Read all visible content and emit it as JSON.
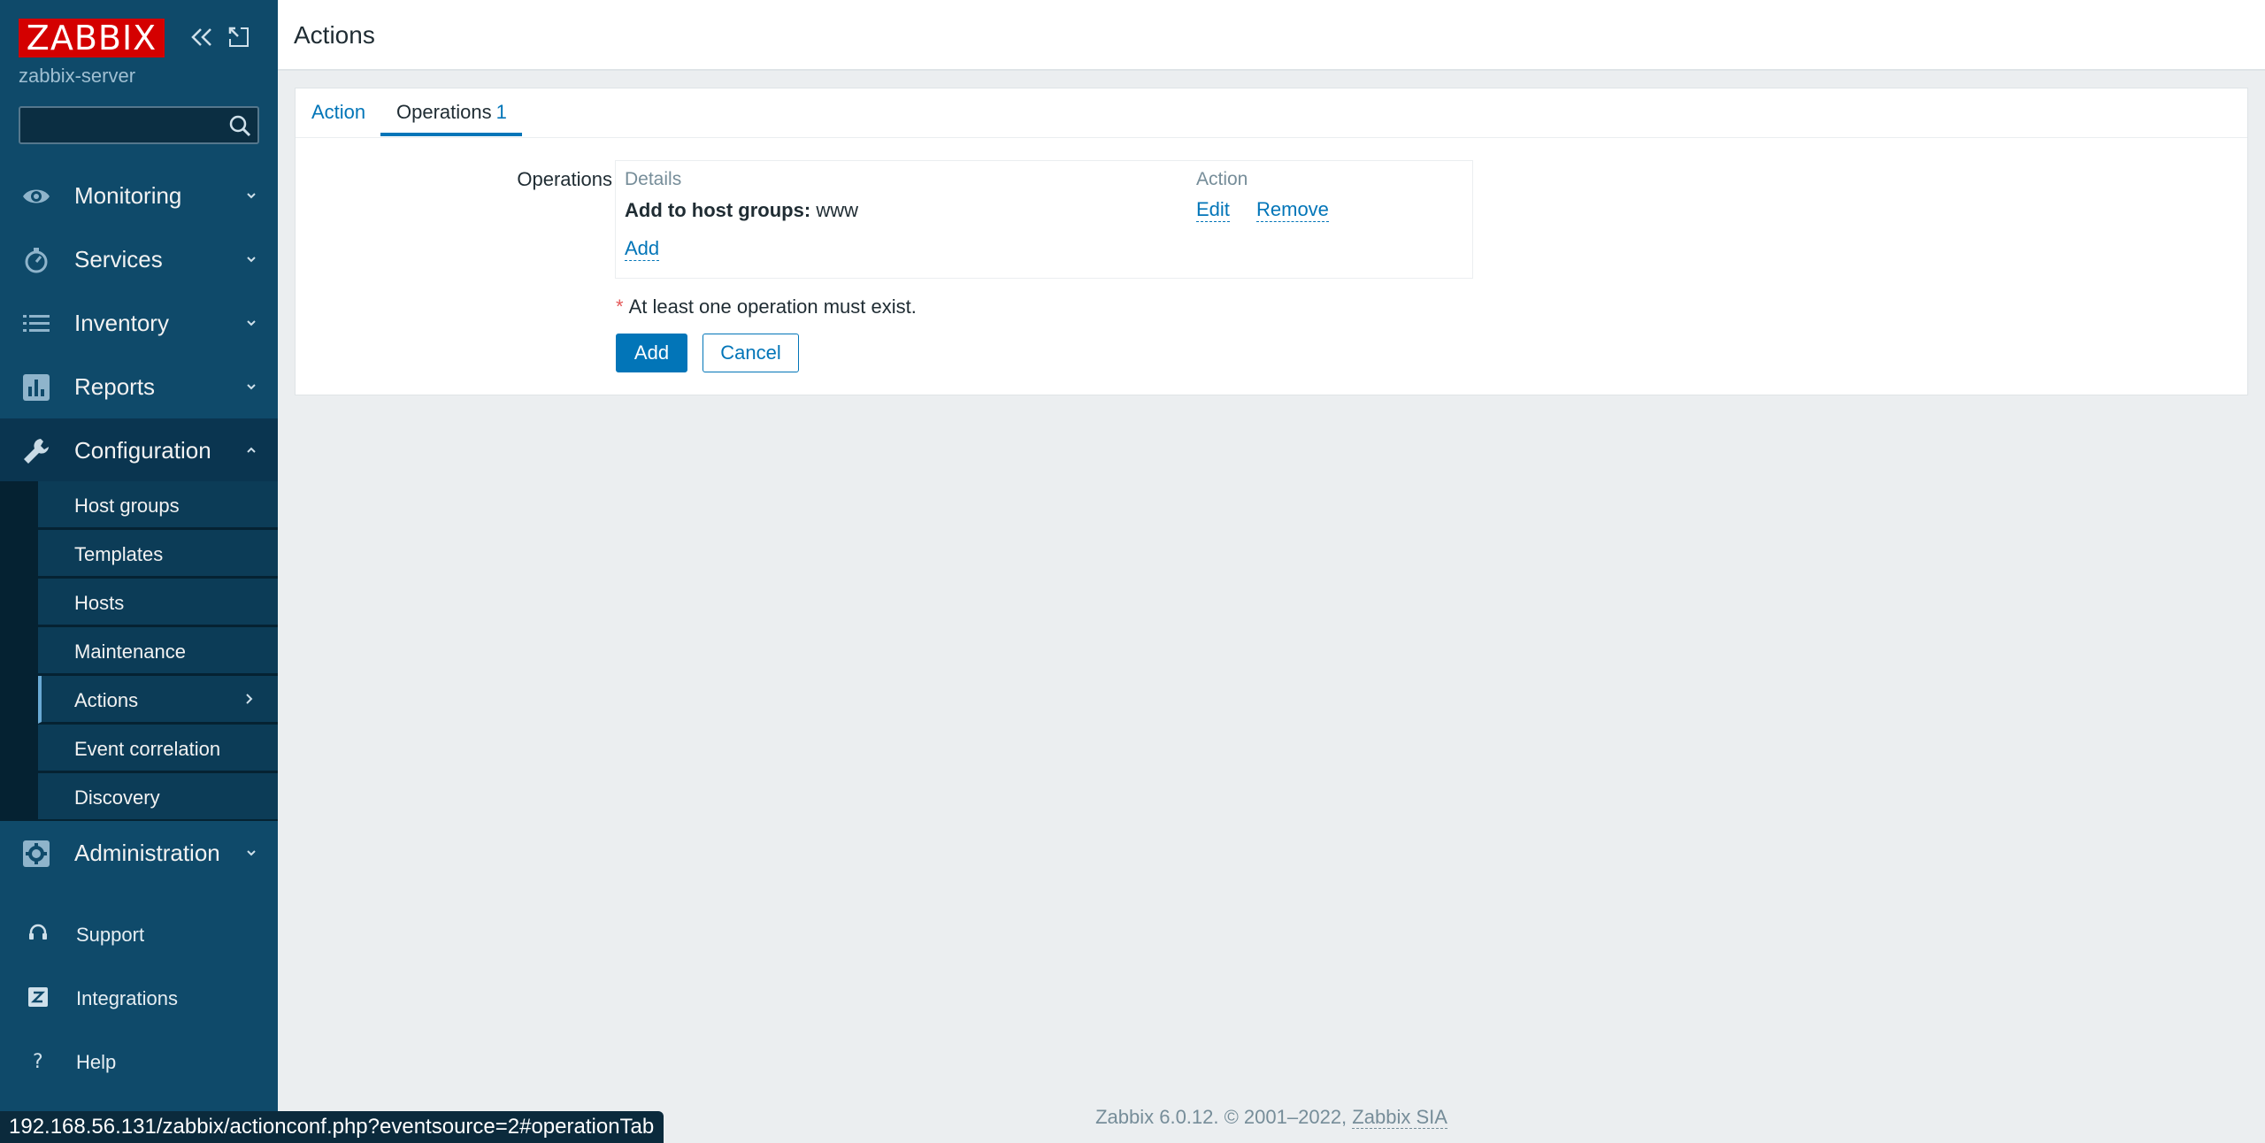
{
  "sidebar": {
    "logo": "ZABBIX",
    "server_name": "zabbix-server",
    "search": {
      "value": "",
      "placeholder": ""
    },
    "menu": [
      {
        "label": "Monitoring",
        "icon": "eye-icon"
      },
      {
        "label": "Services",
        "icon": "stopwatch-icon"
      },
      {
        "label": "Inventory",
        "icon": "list-icon"
      },
      {
        "label": "Reports",
        "icon": "bar-chart-icon"
      },
      {
        "label": "Configuration",
        "icon": "wrench-icon"
      },
      {
        "label": "Administration",
        "icon": "gear-icon"
      }
    ],
    "configuration_submenu": [
      "Host groups",
      "Templates",
      "Hosts",
      "Maintenance",
      "Actions",
      "Event correlation",
      "Discovery"
    ],
    "footer_links": [
      {
        "label": "Support",
        "icon": "headset-icon"
      },
      {
        "label": "Integrations",
        "icon": "z-icon"
      },
      {
        "label": "Help",
        "icon": "question-icon"
      }
    ]
  },
  "header": {
    "title": "Actions"
  },
  "tabs": {
    "action": "Action",
    "operations": "Operations",
    "operations_count": "1"
  },
  "operations": {
    "label": "Operations",
    "col_details": "Details",
    "col_action": "Action",
    "row_bold": "Add to host groups:",
    "row_value": "www",
    "edit": "Edit",
    "remove": "Remove",
    "add": "Add"
  },
  "hint": "At least one operation must exist.",
  "buttons": {
    "add": "Add",
    "cancel": "Cancel"
  },
  "footer": {
    "text": "Zabbix 6.0.12. © 2001–2022,",
    "vendor": "Zabbix SIA"
  },
  "status_url": "192.168.56.131/zabbix/actionconf.php?eventsource=2#operationTab",
  "colors": {
    "sidebar": "#0f4a6a",
    "accent": "#0275b8",
    "logo": "#d40000"
  }
}
